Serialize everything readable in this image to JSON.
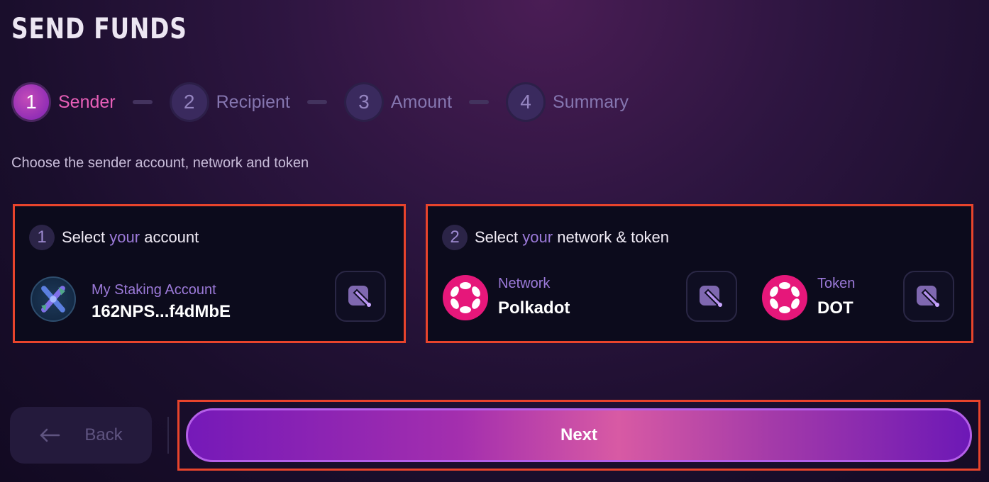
{
  "page": {
    "title": "SEND FUNDS",
    "subtitle": "Choose the sender account, network and token"
  },
  "stepper": {
    "current_step": 1,
    "steps": [
      {
        "number": "1",
        "label": "Sender"
      },
      {
        "number": "2",
        "label": "Recipient"
      },
      {
        "number": "3",
        "label": "Amount"
      },
      {
        "number": "4",
        "label": "Summary"
      }
    ]
  },
  "account_card": {
    "badge": "1",
    "heading_pre": "Select",
    "heading_highlight": "your",
    "heading_post": "account",
    "account_name": "My Staking Account",
    "account_address": "162NPS...f4dMbE",
    "edit_icon": "edit-pencil-icon"
  },
  "network_card": {
    "badge": "2",
    "heading_pre": "Select",
    "heading_highlight": "your",
    "heading_post": "network & token",
    "network_label": "Network",
    "network_value": "Polkadot",
    "token_label": "Token",
    "token_value": "DOT",
    "logo_icon": "polkadot-logo-icon"
  },
  "actions": {
    "back_label": "Back",
    "next_label": "Next"
  },
  "colors": {
    "accent_pink": "#e85fb8",
    "accent_purple": "#9c7ad9",
    "polkadot_pink": "#e6177a",
    "highlight_border": "#e8442c"
  }
}
